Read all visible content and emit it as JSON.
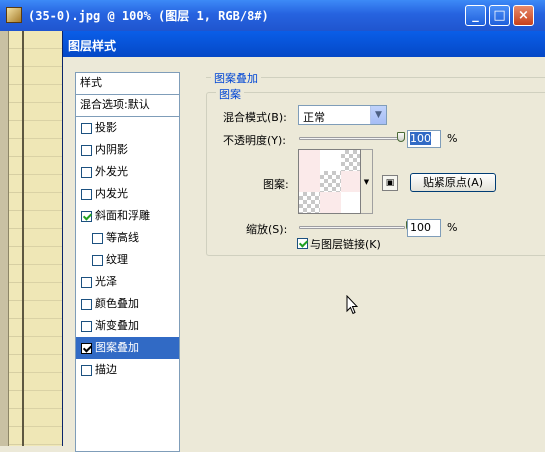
{
  "document": {
    "title": "(35-0).jpg @ 100% (图层 1, RGB/8#)",
    "icon": "photoshop-doc-icon",
    "buttons": {
      "minimize": "_",
      "maximize": "□",
      "close": "×"
    }
  },
  "dialog": {
    "title": "图层样式",
    "style_list": {
      "header": "样式",
      "blend_options": "混合选项:默认",
      "items": [
        {
          "label": "投影",
          "checked": false,
          "sub": false,
          "selected": false
        },
        {
          "label": "内阴影",
          "checked": false,
          "sub": false,
          "selected": false
        },
        {
          "label": "外发光",
          "checked": false,
          "sub": false,
          "selected": false
        },
        {
          "label": "内发光",
          "checked": false,
          "sub": false,
          "selected": false
        },
        {
          "label": "斜面和浮雕",
          "checked": true,
          "sub": false,
          "selected": false
        },
        {
          "label": "等高线",
          "checked": false,
          "sub": true,
          "selected": false
        },
        {
          "label": "纹理",
          "checked": false,
          "sub": true,
          "selected": false
        },
        {
          "label": "光泽",
          "checked": false,
          "sub": false,
          "selected": false
        },
        {
          "label": "颜色叠加",
          "checked": false,
          "sub": false,
          "selected": false
        },
        {
          "label": "渐变叠加",
          "checked": false,
          "sub": false,
          "selected": false
        },
        {
          "label": "图案叠加",
          "checked": true,
          "sub": false,
          "selected": true
        },
        {
          "label": "描边",
          "checked": false,
          "sub": false,
          "selected": false
        }
      ]
    },
    "panel": {
      "outer_title": "图案叠加",
      "inner_title": "图案",
      "blend_mode_label": "混合模式(B):",
      "blend_mode_value": "正常",
      "opacity_label": "不透明度(Y):",
      "opacity_value": "100",
      "opacity_fraction": 1.0,
      "percent": "%",
      "pattern_label": "图案:",
      "snap_button": "贴紧原点(A)",
      "scale_label": "缩放(S):",
      "scale_value": "100",
      "scale_fraction": 0.17,
      "link_label": "与图层链接(K)",
      "link_checked": true
    },
    "colors": {
      "accent": "#316ac5",
      "group_label": "#0046d5",
      "pattern_pink": "#fbeaea"
    }
  }
}
